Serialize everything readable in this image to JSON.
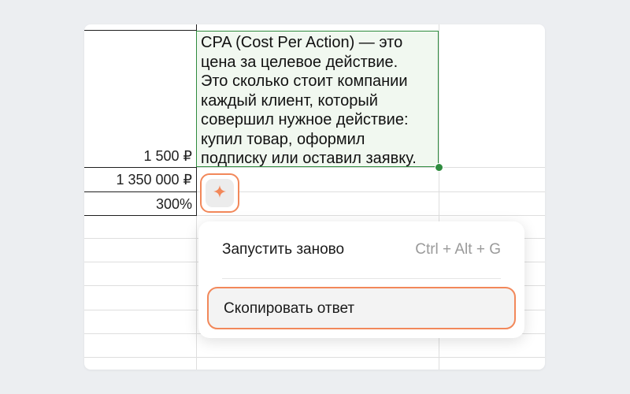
{
  "spreadsheet": {
    "selected_cell_text": "CPA (Cost Per Action) — это\nцена за целевое действие.\nЭто сколько стоит компании\nкаждый клиент, который\nсовершил нужное действие:\nкупил товар, оформил\nподписку или оставил заявку.",
    "values": [
      "1 500 ₽",
      "1 350 000 ₽",
      "300%"
    ]
  },
  "ai_button": {
    "icon": "sparkle-icon"
  },
  "context_menu": {
    "items": [
      {
        "label": "Запустить заново",
        "shortcut": "Ctrl + Alt + G"
      },
      {
        "label": "Скопировать ответ"
      }
    ]
  },
  "colors": {
    "accent": "#f2885a",
    "selection": "#2e8b3e",
    "background": "#eceef1"
  }
}
